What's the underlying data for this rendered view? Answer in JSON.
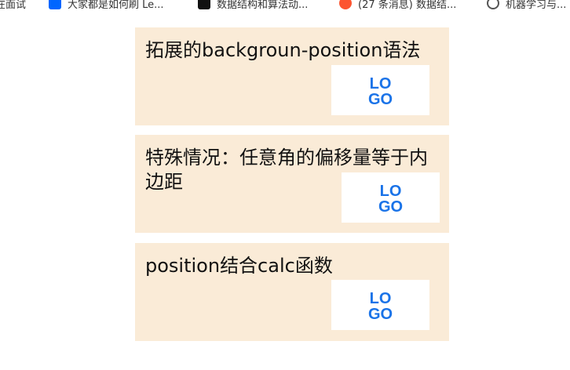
{
  "bookmarks": [
    {
      "label": "在面试",
      "icon": "unknown-icon"
    },
    {
      "label": "大家都是如何刷 Le...",
      "icon": "zhihu-icon"
    },
    {
      "label": "数据结构和算法动...",
      "icon": "black-square-icon"
    },
    {
      "label": "(27 条消息) 数据结...",
      "icon": "csdn-icon"
    },
    {
      "label": "机器学习与...",
      "icon": "folder-icon"
    }
  ],
  "cards": [
    {
      "title": "拓展的backgroun-position语法",
      "logo_text_top": "LO",
      "logo_text_bottom": "GO"
    },
    {
      "title": "特殊情况：任意角的偏移量等于内边距",
      "logo_text_top": "LO",
      "logo_text_bottom": "GO"
    },
    {
      "title": "position结合calc函数",
      "logo_text_top": "LO",
      "logo_text_bottom": "GO"
    }
  ],
  "colors": {
    "card_background": "#faebd7",
    "logo_blue": "#1a73e8"
  }
}
